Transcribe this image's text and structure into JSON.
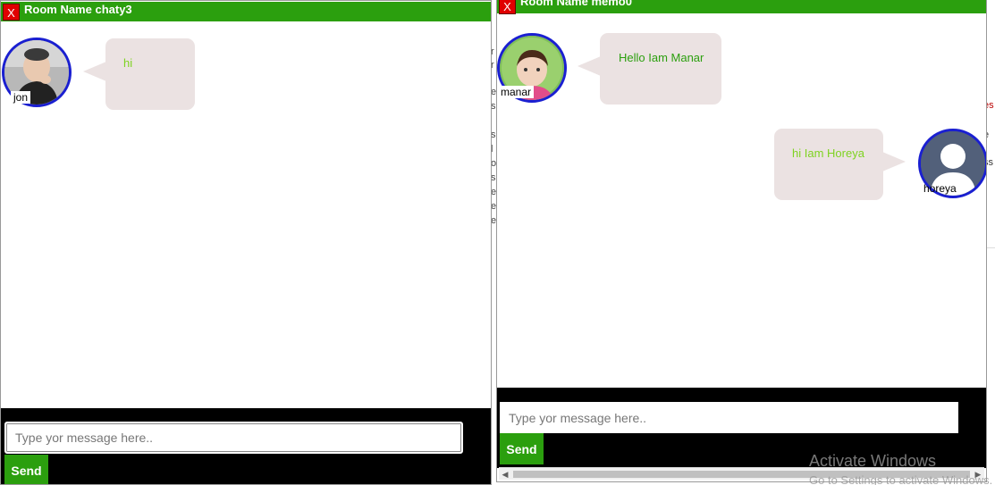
{
  "background": {
    "right_fragments": [
      "es",
      "e",
      "ss"
    ]
  },
  "windows": [
    {
      "close_label": "X",
      "title": "Room Name chaty3",
      "messages": [
        {
          "user": "jon",
          "text": "hi",
          "side": "left",
          "avatar": "baby-photo"
        }
      ],
      "input": {
        "placeholder": "Type yor message here..",
        "value": ""
      },
      "send_label": "Send"
    },
    {
      "close_label": "X",
      "title": "Room Name memo0",
      "messages": [
        {
          "user": "manar",
          "text": "Hello Iam Manar",
          "side": "left",
          "avatar": "girl-photo"
        },
        {
          "user": "horeya",
          "text": "hi Iam Horeya",
          "side": "right",
          "avatar": "default-user-silhouette"
        }
      ],
      "input": {
        "placeholder": "Type yor message here..",
        "value": ""
      },
      "send_label": "Send"
    }
  ],
  "watermark": {
    "line1": "Activate Windows",
    "line2": "Go to Settings to activate Windows."
  },
  "colors": {
    "titlebar": "#2b9f0e",
    "close": "#e00000",
    "avatar_ring": "#1a1fd1",
    "bubble": "#ebe2e2",
    "left_text": "#2b9f0e",
    "right_text": "#7ed321",
    "footer": "#000000"
  }
}
